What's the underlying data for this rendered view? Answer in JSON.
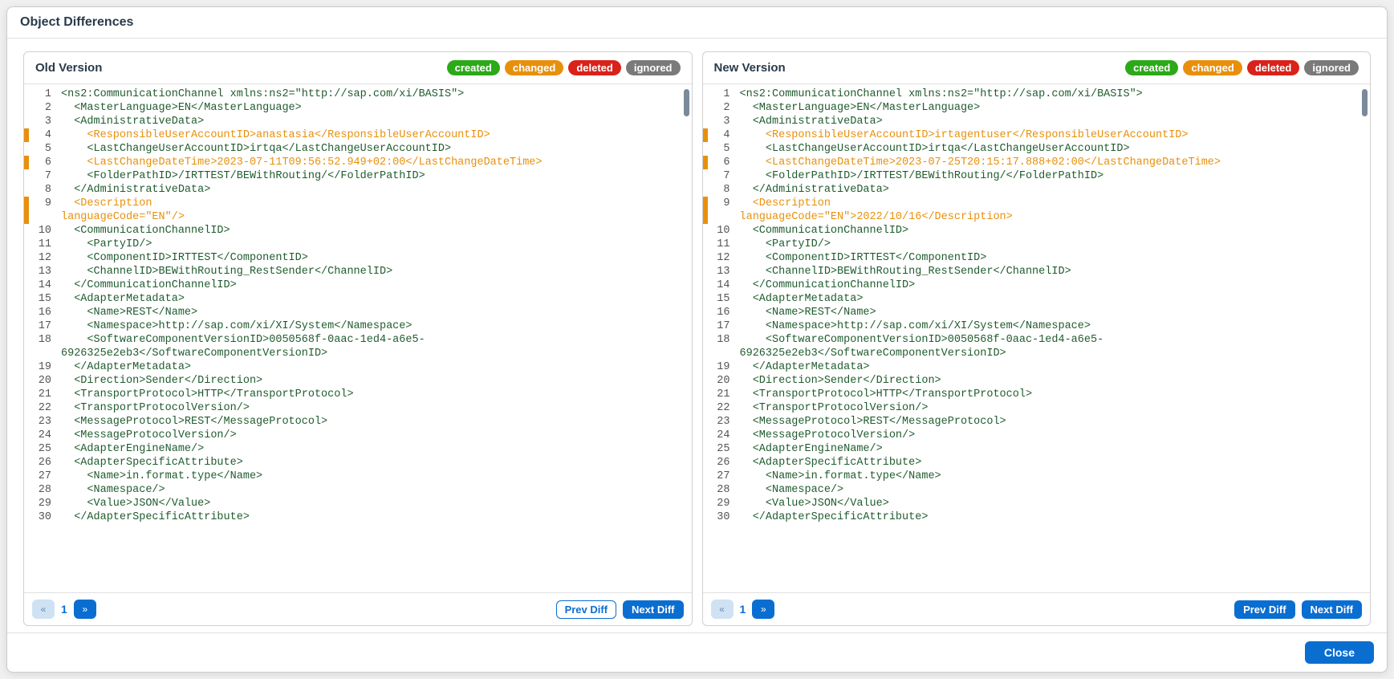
{
  "title": "Object Differences",
  "badges": {
    "created": "created",
    "changed": "changed",
    "deleted": "deleted",
    "ignored": "ignored"
  },
  "panes": {
    "old": {
      "title": "Old Version",
      "page": "1",
      "lines": [
        {
          "n": "1",
          "t": "<ns2:CommunicationChannel xmlns:ns2=\"http://sap.com/xi/BASIS\">",
          "s": "plain"
        },
        {
          "n": "2",
          "t": "  <MasterLanguage>EN</MasterLanguage>",
          "s": "plain"
        },
        {
          "n": "3",
          "t": "  <AdministrativeData>",
          "s": "plain"
        },
        {
          "n": "4",
          "t": "    <ResponsibleUserAccountID>anastasia</ResponsibleUserAccountID>",
          "s": "changed"
        },
        {
          "n": "5",
          "t": "    <LastChangeUserAccountID>irtqa</LastChangeUserAccountID>",
          "s": "plain"
        },
        {
          "n": "6",
          "t": "    <LastChangeDateTime>2023-07-11T09:56:52.949+02:00</LastChangeDateTime>",
          "s": "changed"
        },
        {
          "n": "7",
          "t": "    <FolderPathID>/IRTTEST/BEWithRouting/</FolderPathID>",
          "s": "plain"
        },
        {
          "n": "8",
          "t": "  </AdministrativeData>",
          "s": "plain"
        },
        {
          "n": "9",
          "t": "  <Description",
          "s": "changed"
        },
        {
          "n": "",
          "t": "languageCode=\"EN\"/>",
          "s": "changed",
          "cont": true
        },
        {
          "n": "10",
          "t": "  <CommunicationChannelID>",
          "s": "plain"
        },
        {
          "n": "11",
          "t": "    <PartyID/>",
          "s": "plain"
        },
        {
          "n": "12",
          "t": "    <ComponentID>IRTTEST</ComponentID>",
          "s": "plain"
        },
        {
          "n": "13",
          "t": "    <ChannelID>BEWithRouting_RestSender</ChannelID>",
          "s": "plain"
        },
        {
          "n": "14",
          "t": "  </CommunicationChannelID>",
          "s": "plain"
        },
        {
          "n": "15",
          "t": "  <AdapterMetadata>",
          "s": "plain"
        },
        {
          "n": "16",
          "t": "    <Name>REST</Name>",
          "s": "plain"
        },
        {
          "n": "17",
          "t": "    <Namespace>http://sap.com/xi/XI/System</Namespace>",
          "s": "plain"
        },
        {
          "n": "18",
          "t": "    <SoftwareComponentVersionID>0050568f-0aac-1ed4-a6e5-",
          "s": "plain"
        },
        {
          "n": "",
          "t": "6926325e2eb3</SoftwareComponentVersionID>",
          "s": "plain",
          "cont": true
        },
        {
          "n": "19",
          "t": "  </AdapterMetadata>",
          "s": "plain"
        },
        {
          "n": "20",
          "t": "  <Direction>Sender</Direction>",
          "s": "plain"
        },
        {
          "n": "21",
          "t": "  <TransportProtocol>HTTP</TransportProtocol>",
          "s": "plain"
        },
        {
          "n": "22",
          "t": "  <TransportProtocolVersion/>",
          "s": "plain"
        },
        {
          "n": "23",
          "t": "  <MessageProtocol>REST</MessageProtocol>",
          "s": "plain"
        },
        {
          "n": "24",
          "t": "  <MessageProtocolVersion/>",
          "s": "plain"
        },
        {
          "n": "25",
          "t": "  <AdapterEngineName/>",
          "s": "plain"
        },
        {
          "n": "26",
          "t": "  <AdapterSpecificAttribute>",
          "s": "plain"
        },
        {
          "n": "27",
          "t": "    <Name>in.format.type</Name>",
          "s": "plain"
        },
        {
          "n": "28",
          "t": "    <Namespace/>",
          "s": "plain"
        },
        {
          "n": "29",
          "t": "    <Value>JSON</Value>",
          "s": "plain"
        },
        {
          "n": "30",
          "t": "  </AdapterSpecificAttribute>",
          "s": "plain"
        }
      ]
    },
    "new": {
      "title": "New Version",
      "page": "1",
      "lines": [
        {
          "n": "1",
          "t": "<ns2:CommunicationChannel xmlns:ns2=\"http://sap.com/xi/BASIS\">",
          "s": "plain"
        },
        {
          "n": "2",
          "t": "  <MasterLanguage>EN</MasterLanguage>",
          "s": "plain"
        },
        {
          "n": "3",
          "t": "  <AdministrativeData>",
          "s": "plain"
        },
        {
          "n": "4",
          "t": "    <ResponsibleUserAccountID>irtagentuser</ResponsibleUserAccountID>",
          "s": "changed"
        },
        {
          "n": "5",
          "t": "    <LastChangeUserAccountID>irtqa</LastChangeUserAccountID>",
          "s": "plain"
        },
        {
          "n": "6",
          "t": "    <LastChangeDateTime>2023-07-25T20:15:17.888+02:00</LastChangeDateTime>",
          "s": "changed"
        },
        {
          "n": "7",
          "t": "    <FolderPathID>/IRTTEST/BEWithRouting/</FolderPathID>",
          "s": "plain"
        },
        {
          "n": "8",
          "t": "  </AdministrativeData>",
          "s": "plain"
        },
        {
          "n": "9",
          "t": "  <Description",
          "s": "changed"
        },
        {
          "n": "",
          "t": "languageCode=\"EN\">2022/10/16</Description>",
          "s": "changed",
          "cont": true
        },
        {
          "n": "10",
          "t": "  <CommunicationChannelID>",
          "s": "plain"
        },
        {
          "n": "11",
          "t": "    <PartyID/>",
          "s": "plain"
        },
        {
          "n": "12",
          "t": "    <ComponentID>IRTTEST</ComponentID>",
          "s": "plain"
        },
        {
          "n": "13",
          "t": "    <ChannelID>BEWithRouting_RestSender</ChannelID>",
          "s": "plain"
        },
        {
          "n": "14",
          "t": "  </CommunicationChannelID>",
          "s": "plain"
        },
        {
          "n": "15",
          "t": "  <AdapterMetadata>",
          "s": "plain"
        },
        {
          "n": "16",
          "t": "    <Name>REST</Name>",
          "s": "plain"
        },
        {
          "n": "17",
          "t": "    <Namespace>http://sap.com/xi/XI/System</Namespace>",
          "s": "plain"
        },
        {
          "n": "18",
          "t": "    <SoftwareComponentVersionID>0050568f-0aac-1ed4-a6e5-",
          "s": "plain"
        },
        {
          "n": "",
          "t": "6926325e2eb3</SoftwareComponentVersionID>",
          "s": "plain",
          "cont": true
        },
        {
          "n": "19",
          "t": "  </AdapterMetadata>",
          "s": "plain"
        },
        {
          "n": "20",
          "t": "  <Direction>Sender</Direction>",
          "s": "plain"
        },
        {
          "n": "21",
          "t": "  <TransportProtocol>HTTP</TransportProtocol>",
          "s": "plain"
        },
        {
          "n": "22",
          "t": "  <TransportProtocolVersion/>",
          "s": "plain"
        },
        {
          "n": "23",
          "t": "  <MessageProtocol>REST</MessageProtocol>",
          "s": "plain"
        },
        {
          "n": "24",
          "t": "  <MessageProtocolVersion/>",
          "s": "plain"
        },
        {
          "n": "25",
          "t": "  <AdapterEngineName/>",
          "s": "plain"
        },
        {
          "n": "26",
          "t": "  <AdapterSpecificAttribute>",
          "s": "plain"
        },
        {
          "n": "27",
          "t": "    <Name>in.format.type</Name>",
          "s": "plain"
        },
        {
          "n": "28",
          "t": "    <Namespace/>",
          "s": "plain"
        },
        {
          "n": "29",
          "t": "    <Value>JSON</Value>",
          "s": "plain"
        },
        {
          "n": "30",
          "t": "  </AdapterSpecificAttribute>",
          "s": "plain"
        }
      ]
    }
  },
  "buttons": {
    "prev_diff": "Prev Diff",
    "next_diff": "Next Diff",
    "close": "Close"
  }
}
